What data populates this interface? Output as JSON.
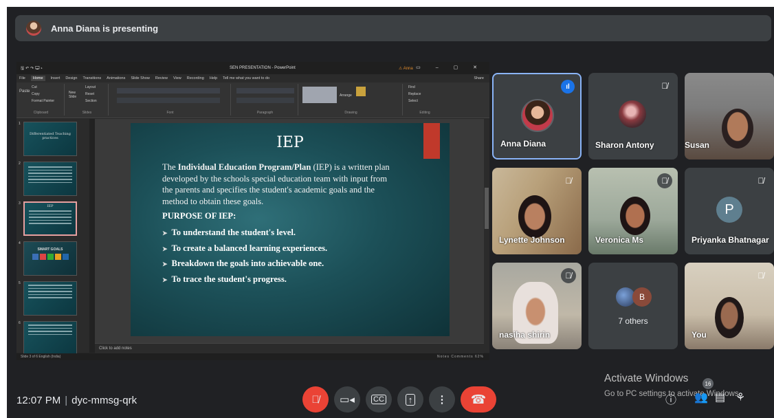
{
  "banner": {
    "text": "Anna Diana is presenting"
  },
  "powerpoint": {
    "window_title": "SEN PRESENTATION - PowerPoint",
    "user": "Anna",
    "menu": [
      "File",
      "Home",
      "Insert",
      "Design",
      "Transitions",
      "Animations",
      "Slide Show",
      "Review",
      "View",
      "Recording",
      "Help",
      "Tell me what you want to do"
    ],
    "share": "Share",
    "ribbon_groups": [
      "Clipboard",
      "Slides",
      "Font",
      "Paragraph",
      "Drawing",
      "Editing"
    ],
    "ribbon_buttons": {
      "paste": "Paste",
      "cut": "Cut",
      "copy": "Copy",
      "format_painter": "Format Painter",
      "new_slide": "New Slide",
      "layout": "Layout",
      "reset": "Reset",
      "section": "Section",
      "arrange": "Arrange",
      "find": "Find",
      "replace": "Replace",
      "select": "Select"
    },
    "thumbnails": [
      {
        "num": "1",
        "title": "Differentiated Teaching practices"
      },
      {
        "num": "2",
        "title": ""
      },
      {
        "num": "3",
        "title": "IEP"
      },
      {
        "num": "4",
        "title": "SMART GOALS"
      },
      {
        "num": "5",
        "title": ""
      },
      {
        "num": "6",
        "title": ""
      }
    ],
    "slide": {
      "title": "IEP",
      "body_pre": "The ",
      "body_bold": "Individual Education Program/Plan",
      "body_post": " (IEP) is a written plan developed by the schools special education team with input from the parents and specifies the student's academic goals and the method to obtain these goals.",
      "heading": "PURPOSE OF IEP:",
      "bullets": [
        "To understand the student's level.",
        "To create a balanced learning experiences.",
        "Breakdown the goals into achievable one.",
        "To trace the student's progress."
      ]
    },
    "notes": "Click to add notes",
    "status_left": "Slide 3 of 6   English (India)",
    "status_right": "Notes   Comments   62%"
  },
  "participants": [
    {
      "name": "Anna Diana",
      "speaking": true
    },
    {
      "name": "Sharon Antony"
    },
    {
      "name": "Susan"
    },
    {
      "name": "Lynette Johnson"
    },
    {
      "name": "Veronica Ms"
    },
    {
      "name": "Priyanka Bhatnagar",
      "initial": "P"
    },
    {
      "name": "nasiha shirin"
    },
    {
      "name": "You"
    }
  ],
  "others": {
    "label": "7 others",
    "initial": "B"
  },
  "bottom": {
    "time": "12:07 PM",
    "meeting_code": "dyc-mmsg-qrk",
    "people_count": "16"
  },
  "watermark": {
    "line1": "Activate Windows",
    "line2": "Go to PC settings to activate Windows."
  },
  "colors": {
    "background": "#202124",
    "tile": "#3c4043",
    "end_call": "#ea4335",
    "speaking": "#1a73e8"
  }
}
